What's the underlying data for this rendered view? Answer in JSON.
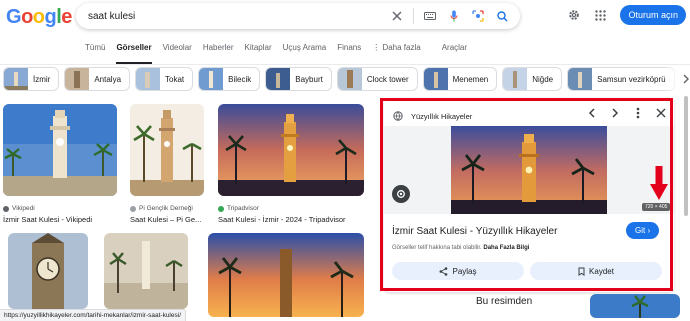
{
  "logo": {
    "letters": [
      "G",
      "o",
      "o",
      "g",
      "l",
      "e"
    ],
    "colors": [
      "#4285F4",
      "#EA4335",
      "#FBBC05",
      "#4285F4",
      "#34A853",
      "#EA4335"
    ]
  },
  "search": {
    "query": "saat kulesi"
  },
  "header": {
    "signin_label": "Oturum açın"
  },
  "tabs": [
    {
      "label": "Tümü"
    },
    {
      "label": "Görseller",
      "active": true
    },
    {
      "label": "Videolar"
    },
    {
      "label": "Haberler"
    },
    {
      "label": "Kitaplar"
    },
    {
      "label": "Uçuş Arama"
    },
    {
      "label": "Finans"
    },
    {
      "label": "Daha fazla"
    }
  ],
  "tools_label": "Araçlar",
  "chips": [
    {
      "label": "İzmir",
      "thumb": "#6a8fb8"
    },
    {
      "label": "Antalya",
      "thumb": "#c9a07a"
    },
    {
      "label": "Tokat",
      "thumb": "#8aa3c0"
    },
    {
      "label": "Bilecik",
      "thumb": "#7b9cc4"
    },
    {
      "label": "Bayburt",
      "thumb": "#4d6fa3"
    },
    {
      "label": "Clock tower",
      "thumb": "#b89574"
    },
    {
      "label": "Menemen",
      "thumb": "#5c7fae"
    },
    {
      "label": "Niğde",
      "thumb": "#9fb5cf"
    },
    {
      "label": "Samsun vezirköprü",
      "thumb": "#6f8fae"
    }
  ],
  "results": [
    {
      "source": "Vikipedi",
      "title": "İzmir Saat Kulesi - Vikipedi",
      "src_color": "#5f6368"
    },
    {
      "source": "Pi Gençlik Derneği",
      "title": "Saat Kulesi – Pi Ge...",
      "src_color": "#9aa0a6"
    },
    {
      "source": "Tripadvisor",
      "title": "Saat Kulesi - İzmir - 2024 - Tripadvisor",
      "src_color": "#34a853"
    }
  ],
  "panel": {
    "site": "Yüzyıllık Hikayeler",
    "title": "İzmir Saat Kulesi - Yüzyıllık Hikayeler",
    "go_label": "Git",
    "note": "Görseller telif hakkına tabi olabilir.",
    "note_link": "Daha Fazla Bilgi",
    "share_label": "Paylaş",
    "save_label": "Kaydet",
    "dims": "720 × 405"
  },
  "bottom_card": "Bu resimden",
  "status_url": "https://yuzyillikhikayeler.com/tarihi-mekanlar/izmir-saat-kulesi/"
}
